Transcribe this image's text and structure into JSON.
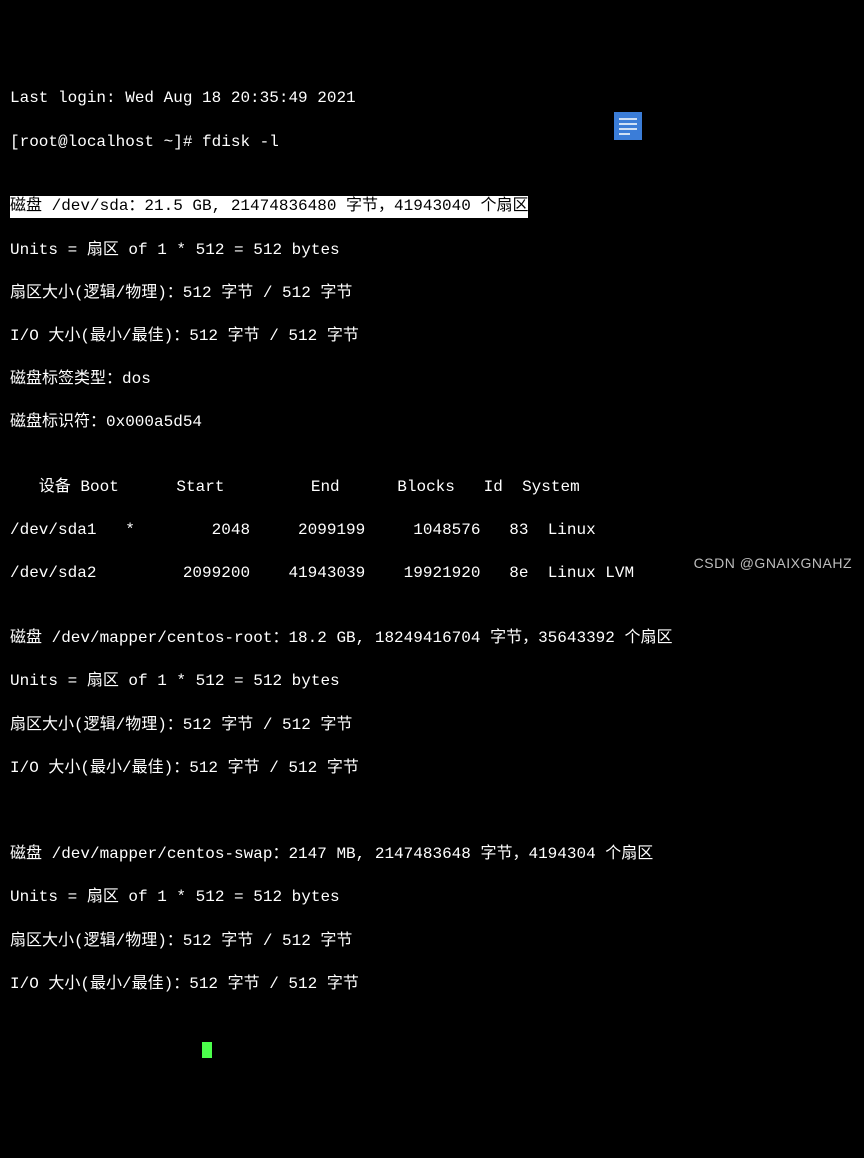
{
  "login_line": "Last login: Wed Aug 18 20:35:49 2021",
  "prompt_line": "[root@localhost ~]# fdisk -l",
  "blank": "",
  "disk1_header": "磁盘 /dev/sda：21.5 GB, 21474836480 字节，41943040 个扇区",
  "units": "Units = 扇区 of 1 * 512 = 512 bytes",
  "sector_size": "扇区大小(逻辑/物理)：512 字节 / 512 字节",
  "io_size": "I/O 大小(最小/最佳)：512 字节 / 512 字节",
  "label_type": "磁盘标签类型：dos",
  "disk_id": "磁盘标识符：0x000a5d54",
  "table_header": "   设备 Boot      Start         End      Blocks   Id  System",
  "row1": "/dev/sda1   *        2048     2099199     1048576   83  Linux",
  "row2": "/dev/sda2         2099200    41943039    19921920   8e  Linux LVM",
  "disk2_header": "磁盘 /dev/mapper/centos-root：18.2 GB, 18249416704 字节，35643392 个扇区",
  "disk2_units": "Units = 扇区 of 1 * 512 = 512 bytes",
  "disk2_sector": "扇区大小(逻辑/物理)：512 字节 / 512 字节",
  "disk2_io": "I/O 大小(最小/最佳)：512 字节 / 512 字节",
  "disk3_header": "磁盘 /dev/mapper/centos-swap：2147 MB, 2147483648 字节，4194304 个扇区",
  "disk3_units": "Units = 扇区 of 1 * 512 = 512 bytes",
  "disk3_sector": "扇区大小(逻辑/物理)：512 字节 / 512 字节",
  "disk3_io": "I/O 大小(最小/最佳)：512 字节 / 512 字节",
  "watermark": "CSDN @GNAIXGNAHZ"
}
